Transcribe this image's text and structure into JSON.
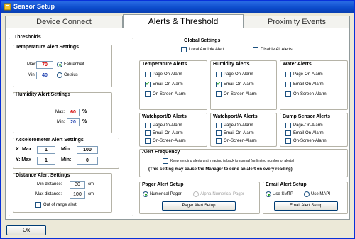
{
  "window": {
    "title": "Sensor Setup"
  },
  "tabs": [
    "Device Connect",
    "Alerts & Threshold",
    "Proximity Events"
  ],
  "thresholds": {
    "title": "Thresholds",
    "temperature": {
      "title": "Temperature Alert Settings",
      "max_label": "Max:",
      "max_value": "70",
      "min_label": "Min:",
      "min_value": "40",
      "fahrenheit": "Fahrenheit",
      "celsius": "Celsius",
      "unit_selected": "Fahrenheit"
    },
    "humidity": {
      "title": "Humidity Alert Settings",
      "max_label": "Max:",
      "max_value": "60",
      "min_label": "Min:",
      "min_value": "20",
      "unit": "%"
    },
    "accelerometer": {
      "title": "Accelerometer Alert Settings",
      "x_label": "X: Max",
      "x_max": "1",
      "x_min_label": "Min:",
      "x_min": "100",
      "y_label": "Y: Max",
      "y_max": "1",
      "y_min_label": "Min:",
      "y_min": "0"
    },
    "distance": {
      "title": "Distance Alert Settings",
      "min_label": "Min distance:",
      "min_value": "30",
      "max_label": "Max distance:",
      "max_value": "100",
      "unit": "cm",
      "out_of_range": "Out of range alert"
    }
  },
  "global": {
    "title": "Global Settings",
    "local_audible": "Local Audible Alert",
    "disable_all": "Disable All Alerts"
  },
  "alert_options": [
    "Page-On-Alarm",
    "Email-On-Alarm",
    "On-Screen-Alarm"
  ],
  "alert_groups": [
    {
      "title": "Temperature Alerts",
      "checked": [
        false,
        true,
        false
      ]
    },
    {
      "title": "Humidity Alerts",
      "checked": [
        false,
        true,
        false
      ]
    },
    {
      "title": "Water Alerts",
      "checked": [
        false,
        false,
        false
      ]
    },
    {
      "title": "Watchport/D Alerts",
      "checked": [
        false,
        false,
        false
      ]
    },
    {
      "title": "Watchport/A Alerts",
      "checked": [
        false,
        false,
        false
      ]
    },
    {
      "title": "Bump Sensor Alerts",
      "checked": [
        false,
        false,
        false
      ]
    }
  ],
  "frequency": {
    "title": "Alert Frequency",
    "keep_sending": "Keep sending alerts until reading is back to normal (unlimited number of alerts)",
    "warning": "(This setting may cause the Manager to send an alert on every reading)"
  },
  "pager": {
    "title": "Pager Alert Setup",
    "numerical": "Numerical Pager",
    "alpha": "Alpha-Numerical Pager",
    "button": "Pager Alert Setup"
  },
  "email": {
    "title": "Email Alert Setup",
    "smtp": "Use SMTP",
    "mapi": "Use MAPI",
    "button": "Email Alert Setup"
  },
  "ok_button": "Ok",
  "colors": {
    "title_bar": "#0a49c9",
    "threshold_red": "#d40000",
    "threshold_blue": "#1c3fb0",
    "check_green": "#21a121"
  }
}
